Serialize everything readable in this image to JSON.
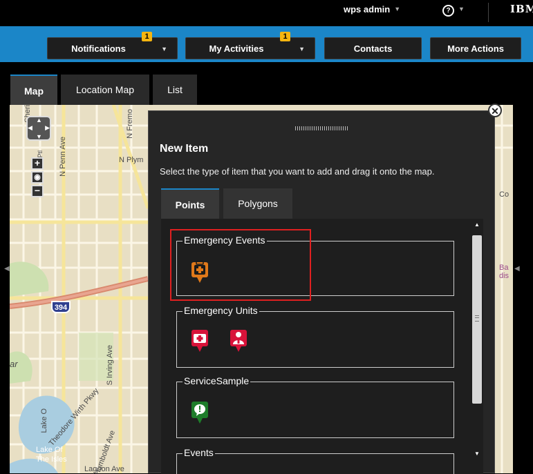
{
  "topbar": {
    "user": "wps admin",
    "help": "?",
    "logo": "IBM"
  },
  "actionbar": {
    "notifications": {
      "label": "Notifications",
      "badge": "1"
    },
    "activities": {
      "label": "My Activities",
      "badge": "1"
    },
    "contacts": {
      "label": "Contacts"
    },
    "more": {
      "label": "More Actions"
    }
  },
  "tabs": {
    "map": "Map",
    "location_map": "Location Map",
    "list": "List"
  },
  "map_labels": {
    "n_fremont": "N Fremo",
    "n_penn": "N Penn Ave",
    "n_plym": "N Plym",
    "ne_broadway": "NE Broadway St",
    "ptl": "Ptl",
    "sheri": "Sheri",
    "hwy394": "394",
    "s_irving": "S Irving Ave",
    "theo_wirth": "Theodore Wirth Pkwy",
    "s_humboldt": "S Humboldt Ave",
    "lake_o": "Lake O",
    "lake_of_isles": "Lake Of",
    "the_isles": "The Isles",
    "lagoon": "Lagoon Ave",
    "ar": "ar",
    "co": "Co",
    "ba": "Ba",
    "dis": "dis"
  },
  "dialog": {
    "title": "New Item",
    "description": "Select the type of item that you want to add and drag it onto the map.",
    "tabs": {
      "points": "Points",
      "polygons": "Polygons"
    },
    "groups": {
      "emergency_events": "Emergency Events",
      "emergency_units": "Emergency Units",
      "service_sample": "ServiceSample",
      "events": "Events"
    },
    "colors": {
      "emergency_event_marker": "#e0791a",
      "ambulance_marker": "#d8133a",
      "responder_marker": "#d8133a",
      "service_marker": "#1e7d2a",
      "highlight": "#e02020",
      "accent": "#1b86c8"
    },
    "icons": {
      "emergency_event": "medical-kit-marker-icon",
      "ambulance": "ambulance-marker-icon",
      "responder": "person-marker-icon",
      "service": "speech-bubble-marker-icon"
    }
  }
}
